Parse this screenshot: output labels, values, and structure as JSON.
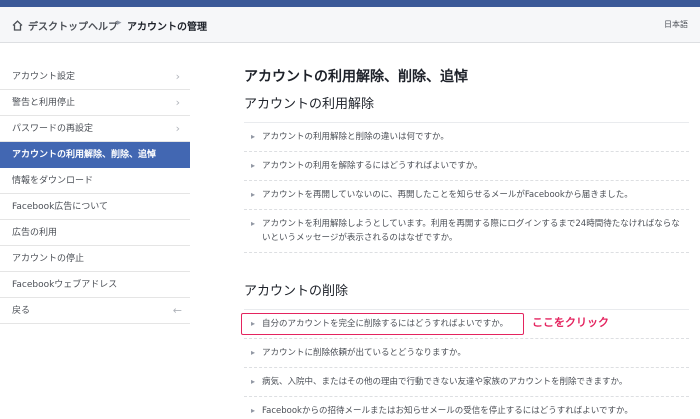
{
  "breadcrumb": {
    "home": "デスクトップヘルプ",
    "separator": "▸",
    "current": "アカウントの管理",
    "language": "日本語"
  },
  "sidebar": {
    "items": [
      {
        "label": "アカウント設定"
      },
      {
        "label": "警告と利用停止"
      },
      {
        "label": "パスワードの再設定"
      },
      {
        "label": "アカウントの利用解除、削除、追悼"
      },
      {
        "label": "情報をダウンロード"
      },
      {
        "label": "Facebook広告について"
      },
      {
        "label": "広告の利用"
      },
      {
        "label": "アカウントの停止"
      },
      {
        "label": "Facebookウェブアドレス"
      },
      {
        "label": "戻る"
      }
    ]
  },
  "main": {
    "title": "アカウントの利用解除、削除、追悼",
    "sections": [
      {
        "title": "アカウントの利用解除",
        "questions": [
          "アカウントの利用解除と削除の違いは何ですか。",
          "アカウントの利用を解除するにはどうすればよいですか。",
          "アカウントを再開していないのに、再開したことを知らせるメールがFacebookから届きました。",
          "アカウントを利用解除しようとしています。利用を再開する際にログインするまで24時間待たなければならないというメッセージが表示されるのはなぜですか。"
        ]
      },
      {
        "title": "アカウントの削除",
        "questions": [
          "自分のアカウントを完全に削除するにはどうすればよいですか。",
          "アカウントに削除依頼が出ているとどうなりますか。",
          "病気、入院中、またはその他の理由で行動できない友達や家族のアカウントを削除できますか。",
          "Facebookからの招待メールまたはお知らせメールの受信を停止するにはどうすればよいですか。"
        ]
      }
    ],
    "annotation": "ここをクリック"
  },
  "colors": {
    "brand": "#3b5998",
    "active_item": "#4267b2",
    "annotation": "#e4245f"
  }
}
